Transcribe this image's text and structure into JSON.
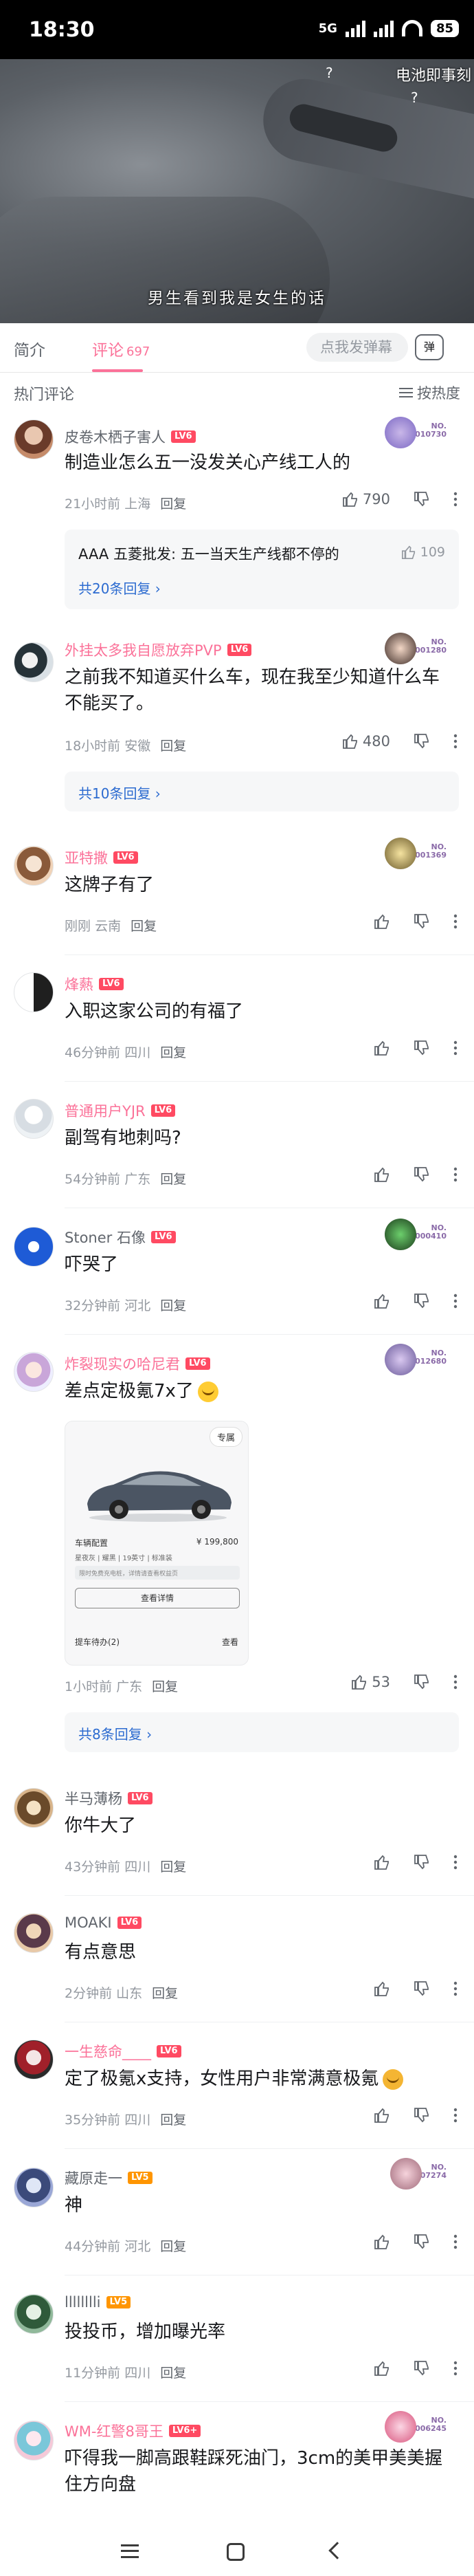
{
  "status_bar": {
    "time": "18:30",
    "network": "5G",
    "battery": "85"
  },
  "video": {
    "subtitle": "男生看到我是女生的话",
    "danmaku": "电池即事刻",
    "question_marks": [
      "?",
      "?"
    ]
  },
  "tabs": {
    "intro": "简介",
    "comments": "评论",
    "comment_count": "697",
    "danmu_placeholder": "点我发弹幕",
    "danmu_button": "弹"
  },
  "list_header": {
    "title": "热门评论",
    "sort": "按热度"
  },
  "comments": [
    {
      "user": "皮卷木栖子害人",
      "level": "LV6",
      "badge_no": "NO.",
      "badge_num": "010730",
      "text": "制造业怎么五一没发关心产线工人的",
      "time": "21小时前",
      "location": "上海",
      "reply": "回复",
      "likes": "790",
      "sub_reply": "AAA 五菱批发: 五一当天生产线都不停的",
      "sub_likes": "109",
      "more_replies": "共20条回复"
    },
    {
      "user": "外挂太多我自愿放弃PVP",
      "level": "LV6",
      "badge_no": "NO.",
      "badge_num": "001280",
      "text": "之前我不知道买什么车，现在我至少知道什么车不能买了。",
      "time": "18小时前",
      "location": "安徽",
      "reply": "回复",
      "likes": "480",
      "more_replies": "共10条回复"
    },
    {
      "user": "亚特撒",
      "level": "LV6",
      "badge_no": "NO.",
      "badge_num": "001369",
      "text": "这牌子有了",
      "time": "刚刚",
      "location": "云南",
      "reply": "回复"
    },
    {
      "user": "烽爇",
      "level": "LV6",
      "text": "入职这家公司的有福了",
      "time": "46分钟前",
      "location": "四川",
      "reply": "回复"
    },
    {
      "user": "普通用户YJR",
      "level": "LV6",
      "text": "副驾有地刺吗?",
      "time": "54分钟前",
      "location": "广东",
      "reply": "回复"
    },
    {
      "user": "Stoner 石像",
      "level": "LV6",
      "badge_no": "NO.",
      "badge_num": "000410",
      "text": "吓哭了",
      "time": "32分钟前",
      "location": "河北",
      "reply": "回复"
    },
    {
      "user": "炸裂现实の哈尼君",
      "level": "LV6",
      "badge_no": "NO.",
      "badge_num": "012680",
      "text": "差点定极氪7x了",
      "time": "1小时前",
      "location": "广东",
      "reply": "回复",
      "likes": "53",
      "more_replies": "共8条回复",
      "image": {
        "pill": "专属",
        "r1": "车辆配置",
        "r1r": "¥ 199,800",
        "r2": "星夜灰 | 耀黑 | 19英寸 | 标准装",
        "r3": "限时免费充电桩，详情请查看权益页",
        "btn": "查看详情",
        "r4": "提车待办(2)",
        "r4r": "查看"
      }
    },
    {
      "user": "半马薄杨",
      "level": "LV6",
      "text": "你牛大了",
      "time": "43分钟前",
      "location": "四川",
      "reply": "回复"
    },
    {
      "user": "MOAKI",
      "level": "LV6",
      "text": "有点意思",
      "time": "2分钟前",
      "location": "山东",
      "reply": "回复"
    },
    {
      "user": "一生慈命____",
      "level": "LV6",
      "text": "定了极氪x支持，女性用户非常满意极氪",
      "time": "35分钟前",
      "location": "四川",
      "reply": "回复"
    },
    {
      "user": "藏原走一",
      "level": "LV5",
      "badge_no": "NO.",
      "badge_num": "07274",
      "text": "神",
      "time": "44分钟前",
      "location": "河北",
      "reply": "回复"
    },
    {
      "user": "lllllllli",
      "level": "LV5",
      "text": "投投币，增加曝光率",
      "time": "11分钟前",
      "location": "四川",
      "reply": "回复"
    },
    {
      "user": "WM-红警8哥王",
      "level": "LV6+",
      "badge_no": "NO.",
      "badge_num": "006245",
      "text": "吓得我一脚高跟鞋踩死油门，3cm的美甲美美握住方向盘"
    }
  ],
  "colors": {
    "accent": "#fb7299",
    "link": "#2c6bd0"
  }
}
